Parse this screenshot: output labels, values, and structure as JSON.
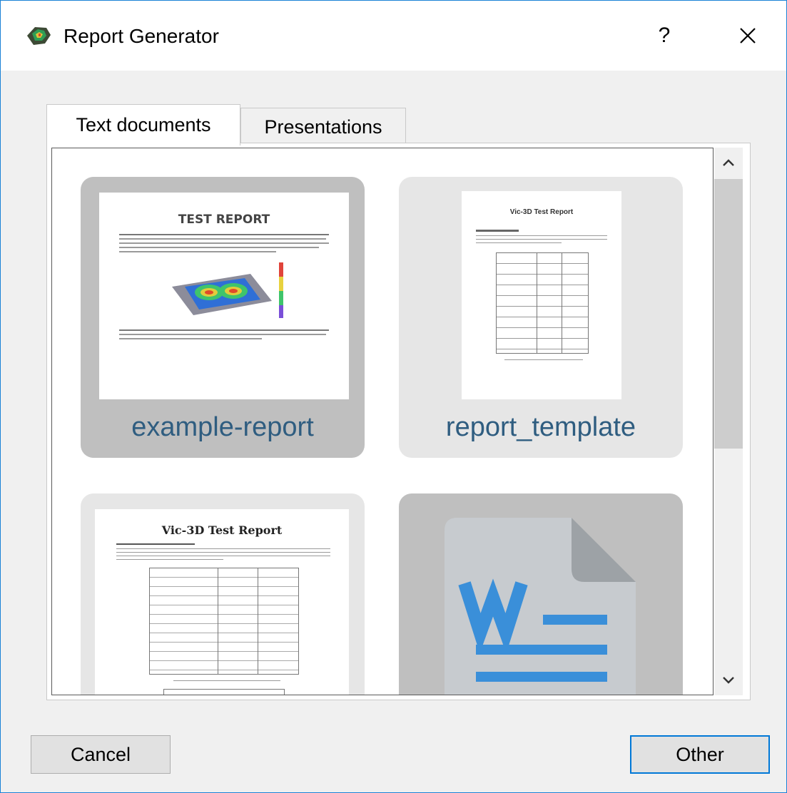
{
  "window": {
    "title": "Report Generator",
    "help_label": "?",
    "app_icon": "app-logo-icon",
    "close_icon": "close-icon"
  },
  "tabs": [
    {
      "label": "Text documents",
      "active": true
    },
    {
      "label": "Presentations",
      "active": false
    }
  ],
  "templates": [
    {
      "name": "example-report",
      "selected": true,
      "thumb_title": "TEST REPORT"
    },
    {
      "name": "report_template",
      "selected": false,
      "thumb_title": "Vic-3D Test Report"
    },
    {
      "name": "",
      "selected": false,
      "thumb_title": "Vic-3D Test Report"
    },
    {
      "name": "",
      "selected": false,
      "icon": "word-document-icon"
    }
  ],
  "scrollbar": {
    "up_icon": "chevron-up-icon",
    "down_icon": "chevron-down-icon"
  },
  "buttons": {
    "cancel": "Cancel",
    "other": "Other"
  },
  "colors": {
    "accent": "#0078d7",
    "template_name": "#2f5d80",
    "word_blue": "#3a8fd9"
  }
}
